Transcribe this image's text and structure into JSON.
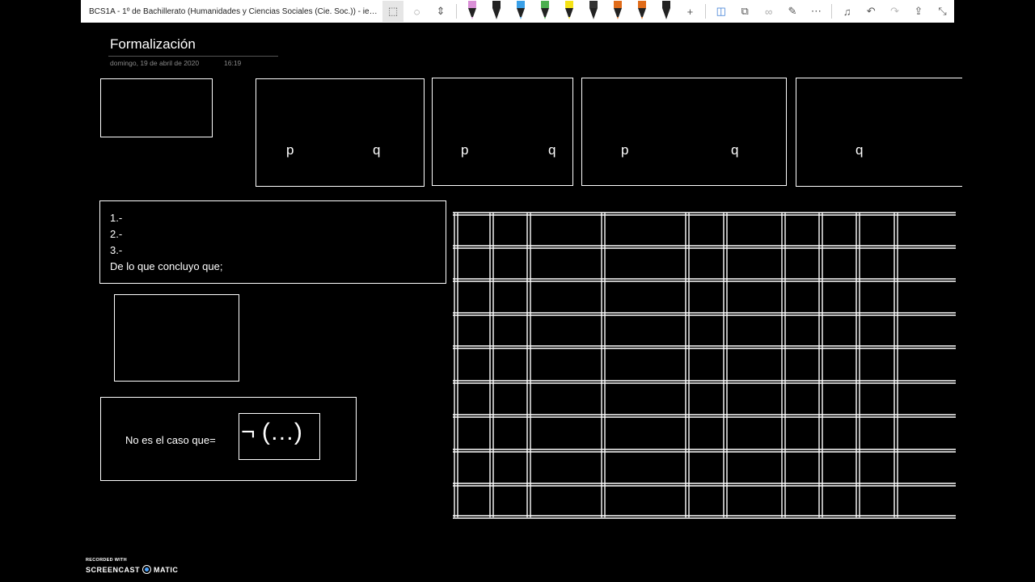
{
  "toolbar": {
    "doc_title": "BCS1A - 1º de Bachillerato (Humanidades y Ciencias Sociales (Cie. Soc.)) - ies.alp...",
    "icons": [
      "select-icon",
      "lasso-icon",
      "insert-space-icon",
      "pen-icon",
      "add-pen-icon",
      "shapes-icon",
      "convert-icon",
      "ink-to-math-icon",
      "ruler-icon",
      "more-icon",
      "bell-icon",
      "undo-icon",
      "redo-icon",
      "share-icon",
      "collapse-icon"
    ],
    "pen_colors": [
      "#d98fd6",
      "#222222",
      "#3aa0e8",
      "#4caf50",
      "#f5e216",
      "#333333",
      "#e06c1a",
      "#e06c1a",
      "#222222"
    ]
  },
  "page": {
    "title": "Formalización",
    "date": "domingo, 19 de abril de 2020",
    "time": "16:19"
  },
  "truth_headers": {
    "box1": {
      "p": "p",
      "q": "q"
    },
    "box2": {
      "p": "p",
      "q": "q"
    },
    "box3": {
      "p": "p",
      "q": "q"
    },
    "box4": {
      "q": "q"
    }
  },
  "argument": {
    "line1": "1.-",
    "line2": "2.-",
    "line3": "3.-",
    "conclusion": "De lo que concluyo que;"
  },
  "negation": {
    "label": "No es el caso que=",
    "formula": "¬ (…)"
  },
  "watermark": {
    "top": "RECORDED WITH",
    "brand_left": "SCREENCAST",
    "brand_right": "MATIC"
  }
}
